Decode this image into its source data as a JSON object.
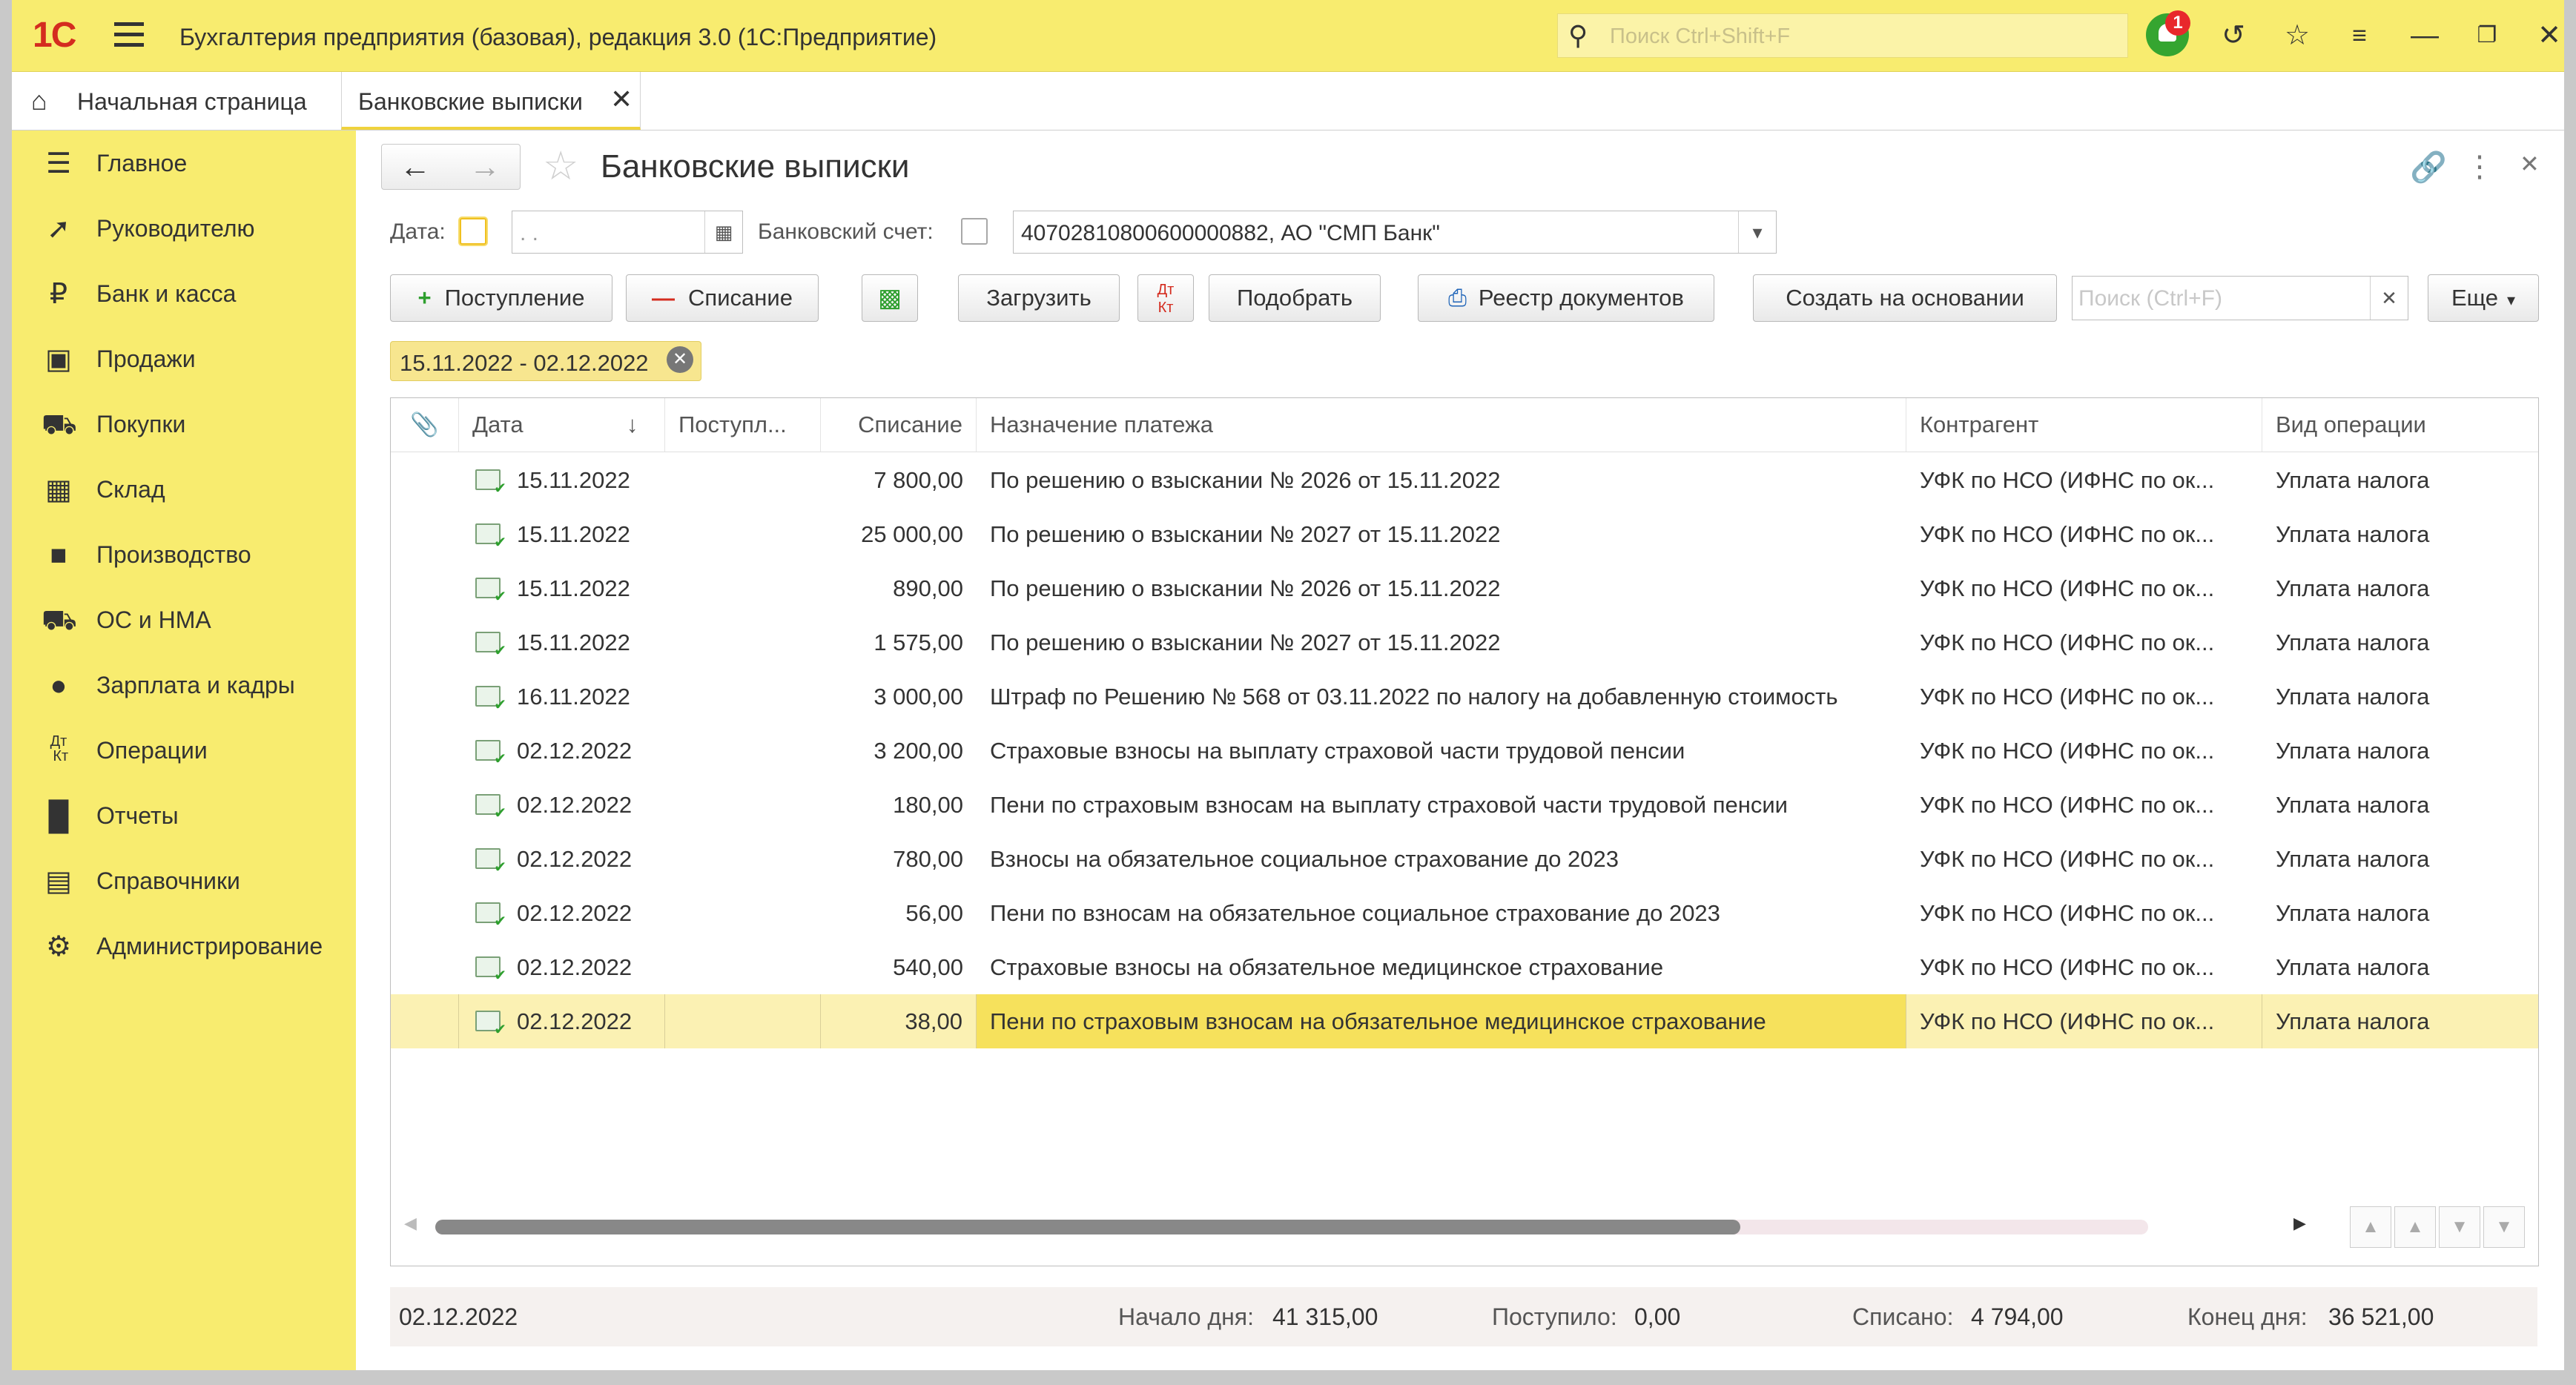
{
  "app": {
    "logo": "1С",
    "title": "Бухгалтерия предприятия (базовая), редакция 3.0  (1С:Предприятие)",
    "search_placeholder": "Поиск Ctrl+Shift+F",
    "notification_count": "1"
  },
  "tabs": {
    "home": "Начальная страница",
    "active": "Банковские выписки"
  },
  "sidebar": {
    "items": [
      {
        "label": "Главное",
        "icon": "menu-icon"
      },
      {
        "label": "Руководителю",
        "icon": "trend-icon"
      },
      {
        "label": "Банк и касса",
        "icon": "ruble-icon"
      },
      {
        "label": "Продажи",
        "icon": "bag-icon"
      },
      {
        "label": "Покупки",
        "icon": "cart-icon"
      },
      {
        "label": "Склад",
        "icon": "warehouse-icon"
      },
      {
        "label": "Производство",
        "icon": "factory-icon"
      },
      {
        "label": "ОС и НМА",
        "icon": "truck-icon"
      },
      {
        "label": "Зарплата и кадры",
        "icon": "person-icon"
      },
      {
        "label": "Операции",
        "icon": "dt-kt-icon"
      },
      {
        "label": "Отчеты",
        "icon": "bar-chart-icon"
      },
      {
        "label": "Справочники",
        "icon": "books-icon"
      },
      {
        "label": "Администрирование",
        "icon": "gear-icon"
      }
    ]
  },
  "form": {
    "title": "Банковские выписки",
    "date_label": "Дата:",
    "date_value": " .  .",
    "account_label": "Банковский счет:",
    "account_value": "40702810800600000882, АО \"СМП Банк\"",
    "filter_chip": "15.11.2022 - 02.12.2022",
    "list_search_placeholder": "Поиск (Ctrl+F)"
  },
  "toolbar": {
    "receipt": "Поступление",
    "writeoff": "Списание",
    "load": "Загрузить",
    "pick": "Подобрать",
    "registry": "Реестр документов",
    "create_based": "Создать на основании",
    "more": "Еще",
    "dtkt_top": "Дт",
    "dtkt_bottom": "Кт"
  },
  "table": {
    "columns": {
      "date": "Дата",
      "receipt": "Поступл...",
      "writeoff": "Списание",
      "purpose": "Назначение платежа",
      "counterparty": "Контрагент",
      "operation": "Вид операции"
    },
    "rows": [
      {
        "date": "15.11.2022",
        "receipt": "",
        "writeoff": "7 800,00",
        "purpose": "По решению о взыскании № 2026 от 15.11.2022",
        "counterparty": "УФК по НСО (ИФНС по ок...",
        "operation": "Уплата налога"
      },
      {
        "date": "15.11.2022",
        "receipt": "",
        "writeoff": "25 000,00",
        "purpose": "По решению о взыскании № 2027 от 15.11.2022",
        "counterparty": "УФК по НСО (ИФНС по ок...",
        "operation": "Уплата налога"
      },
      {
        "date": "15.11.2022",
        "receipt": "",
        "writeoff": "890,00",
        "purpose": "По решению о взыскании № 2026 от 15.11.2022",
        "counterparty": "УФК по НСО (ИФНС по ок...",
        "operation": "Уплата налога"
      },
      {
        "date": "15.11.2022",
        "receipt": "",
        "writeoff": "1 575,00",
        "purpose": "По решению о взыскании № 2027 от 15.11.2022",
        "counterparty": "УФК по НСО (ИФНС по ок...",
        "operation": "Уплата налога"
      },
      {
        "date": "16.11.2022",
        "receipt": "",
        "writeoff": "3 000,00",
        "purpose": "Штраф по Решению № 568 от 03.11.2022 по налогу на добавленную стоимость",
        "counterparty": "УФК по НСО (ИФНС по ок...",
        "operation": "Уплата налога"
      },
      {
        "date": "02.12.2022",
        "receipt": "",
        "writeoff": "3 200,00",
        "purpose": "Страховые взносы на выплату страховой части трудовой пенсии",
        "counterparty": "УФК по НСО (ИФНС по ок...",
        "operation": "Уплата налога"
      },
      {
        "date": "02.12.2022",
        "receipt": "",
        "writeoff": "180,00",
        "purpose": "Пени по страховым взносам на выплату страховой части трудовой пенсии",
        "counterparty": "УФК по НСО (ИФНС по ок...",
        "operation": "Уплата налога"
      },
      {
        "date": "02.12.2022",
        "receipt": "",
        "writeoff": "780,00",
        "purpose": "Взносы на обязательное социальное страхование до 2023",
        "counterparty": "УФК по НСО (ИФНС по ок...",
        "operation": "Уплата налога"
      },
      {
        "date": "02.12.2022",
        "receipt": "",
        "writeoff": "56,00",
        "purpose": "Пени по взносам на обязательное социальное страхование до 2023",
        "counterparty": "УФК по НСО (ИФНС по ок...",
        "operation": "Уплата налога"
      },
      {
        "date": "02.12.2022",
        "receipt": "",
        "writeoff": "540,00",
        "purpose": "Страховые взносы на обязательное медицинское страхование",
        "counterparty": "УФК по НСО (ИФНС по ок...",
        "operation": "Уплата налога"
      },
      {
        "date": "02.12.2022",
        "receipt": "",
        "writeoff": "38,00",
        "purpose": "Пени по страховым взносам на обязательное медицинское страхование",
        "counterparty": "УФК по НСО (ИФНС по ок...",
        "operation": "Уплата налога"
      }
    ]
  },
  "footer": {
    "date": "02.12.2022",
    "start_label": "Начало дня:",
    "start_value": "41 315,00",
    "in_label": "Поступило:",
    "in_value": "0,00",
    "out_label": "Списано:",
    "out_value": "4 794,00",
    "end_label": "Конец дня:",
    "end_value": "36 521,00"
  },
  "colors": {
    "accent_yellow": "#f8ec6f",
    "selected_row": "#fbf1b3",
    "selected_cell": "#f6e15c",
    "brand_red": "#d42c1f"
  }
}
